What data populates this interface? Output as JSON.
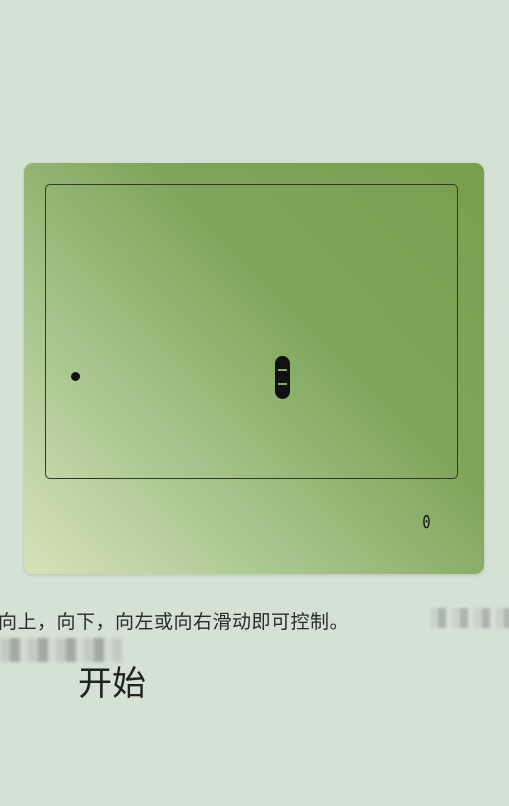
{
  "game": {
    "score": "0",
    "snake_segments": 3
  },
  "instructions": {
    "text": "向上，向下，向左或向右滑动即可控制。"
  },
  "controls": {
    "start_label": "开始"
  }
}
